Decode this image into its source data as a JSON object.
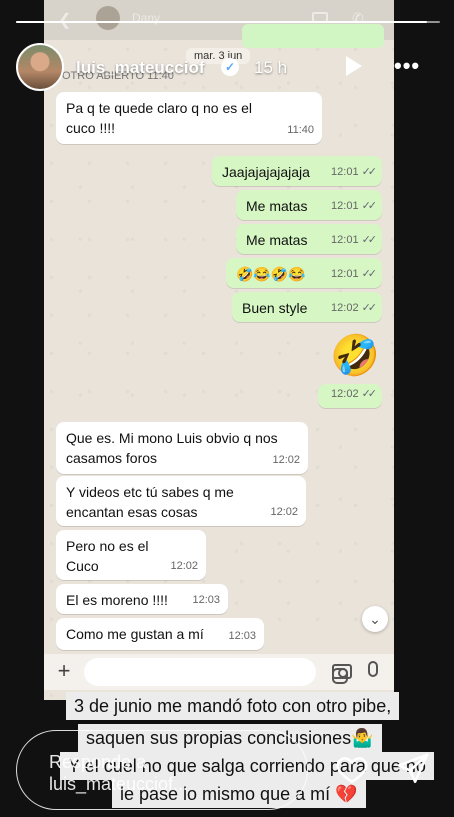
{
  "story": {
    "username": "luis_mateucciof",
    "age": "15 h",
    "progress": 0.97,
    "faded_header": {
      "back": "❮",
      "contact_name": "Dany"
    }
  },
  "chat": {
    "date_label": "mar. 3 jun",
    "hidden_row": "OTRO ABIERTO 11:40",
    "messages": [
      {
        "dir": "in",
        "text": "Pa q te quede claro q no es el cuco !!!!",
        "time": "11:40"
      },
      {
        "dir": "out",
        "text": "Jaajajajajajaja",
        "time": "12:01"
      },
      {
        "dir": "out",
        "text": "Me matas",
        "time": "12:01"
      },
      {
        "dir": "out",
        "text": "Me matas",
        "time": "12:01"
      },
      {
        "dir": "out",
        "text": "🤣😂🤣😂",
        "time": "12:01"
      },
      {
        "dir": "out",
        "text": "Buen style",
        "time": "12:02"
      },
      {
        "dir": "out",
        "text": "🤣",
        "time": "12:02"
      },
      {
        "dir": "in",
        "text": "Que es. Mi mono Luis obvio q nos casamos foros",
        "time": "12:02"
      },
      {
        "dir": "in",
        "text": "Y videos etc tú sabes q me encantan esas cosas",
        "time": "12:02"
      },
      {
        "dir": "in",
        "text": "Pero no es el Cuco",
        "time": "12:02"
      },
      {
        "dir": "in",
        "text": "El es moreno !!!!",
        "time": "12:03"
      },
      {
        "dir": "in",
        "text": "Como me gustan a mí",
        "time": "12:03"
      }
    ],
    "ticks": "✓✓",
    "input_plus": "+",
    "scroll_down": "⌄"
  },
  "caption": {
    "line1": "3 de junio me mandó foto con otro pibe,",
    "line2": "saquen sus propias conclusiones🤷‍♂️",
    "line3": "Y el cuel no que salga corriendo para que no",
    "line4": "le pase lo mismo que a mí 💔"
  },
  "reply": {
    "placeholder": "Responde a luis_mateucciof..."
  },
  "icons": {
    "verified": "verified-badge-icon",
    "play": "play-icon",
    "more": "more-options-icon",
    "heart": "heart-icon",
    "send": "send-icon"
  }
}
